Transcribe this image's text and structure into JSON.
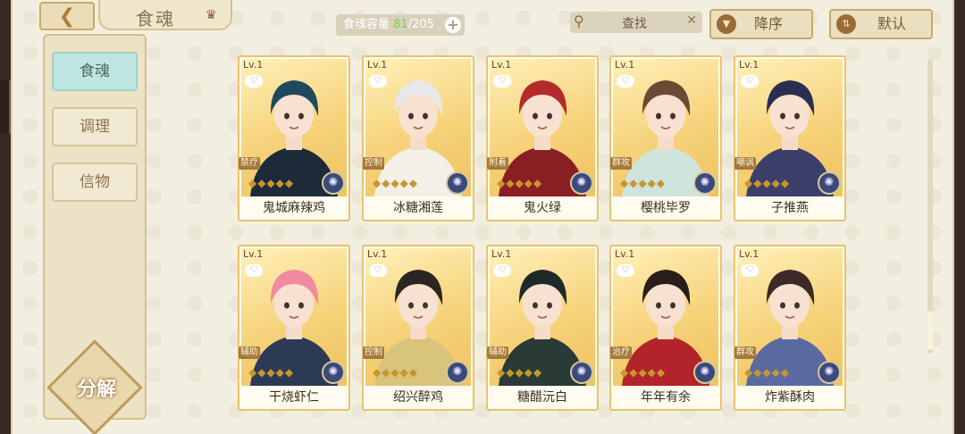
{
  "header": {
    "title": "食魂",
    "capacity_label": "食魂容量",
    "capacity_current": "81",
    "capacity_max": "/205",
    "search_label": "查找",
    "sort_order_label": "降序",
    "sort_mode_label": "默认"
  },
  "sidebar": {
    "items": [
      {
        "label": "食魂",
        "active": true
      },
      {
        "label": "调理",
        "active": false
      },
      {
        "label": "信物",
        "active": false
      }
    ],
    "decompose_label": "分解"
  },
  "cards": [
    {
      "level": "Lv.1",
      "name": "鬼城麻辣鸡",
      "role": "禁疗",
      "hair": "#1f4a5c",
      "outfit": "#1d2a3a"
    },
    {
      "level": "Lv.1",
      "name": "冰糖湘莲",
      "role": "控制",
      "hair": "#e8e8ea",
      "outfit": "#f4f0e8"
    },
    {
      "level": "Lv.1",
      "name": "鬼火绿",
      "role": "附着",
      "hair": "#b52a2a",
      "outfit": "#8a1f22"
    },
    {
      "level": "Lv.1",
      "name": "樱桃毕罗",
      "role": "群攻",
      "hair": "#6b4a33",
      "outfit": "#cfe4dd"
    },
    {
      "level": "Lv.1",
      "name": "子推燕",
      "role": "嘲讽",
      "hair": "#2a2f52",
      "outfit": "#3c3f6a"
    },
    {
      "level": "Lv.1",
      "name": "干烧虾仁",
      "role": "辅助",
      "hair": "#f08aa0",
      "outfit": "#2c3a55"
    },
    {
      "level": "Lv.1",
      "name": "绍兴醉鸡",
      "role": "控制",
      "hair": "#2b2622",
      "outfit": "#d8c47a"
    },
    {
      "level": "Lv.1",
      "name": "糖醋沅白",
      "role": "辅助",
      "hair": "#1e2a2a",
      "outfit": "#2a3a36"
    },
    {
      "level": "Lv.1",
      "name": "年年有余",
      "role": "治疗",
      "hair": "#2a1e1a",
      "outfit": "#b3232a"
    },
    {
      "level": "Lv.1",
      "name": "炸紫酥肉",
      "role": "群攻",
      "hair": "#3b2a26",
      "outfit": "#5a6aa0"
    }
  ],
  "icons": {
    "back": "back-arrow-icon",
    "title": "crown-icon",
    "plus": "plus-icon",
    "search": "search-icon",
    "clear": "close-icon",
    "sort_order": "sort-desc-icon",
    "sort_mode": "swap-icon",
    "element": "element-icon",
    "heart": "favorite-icon"
  }
}
